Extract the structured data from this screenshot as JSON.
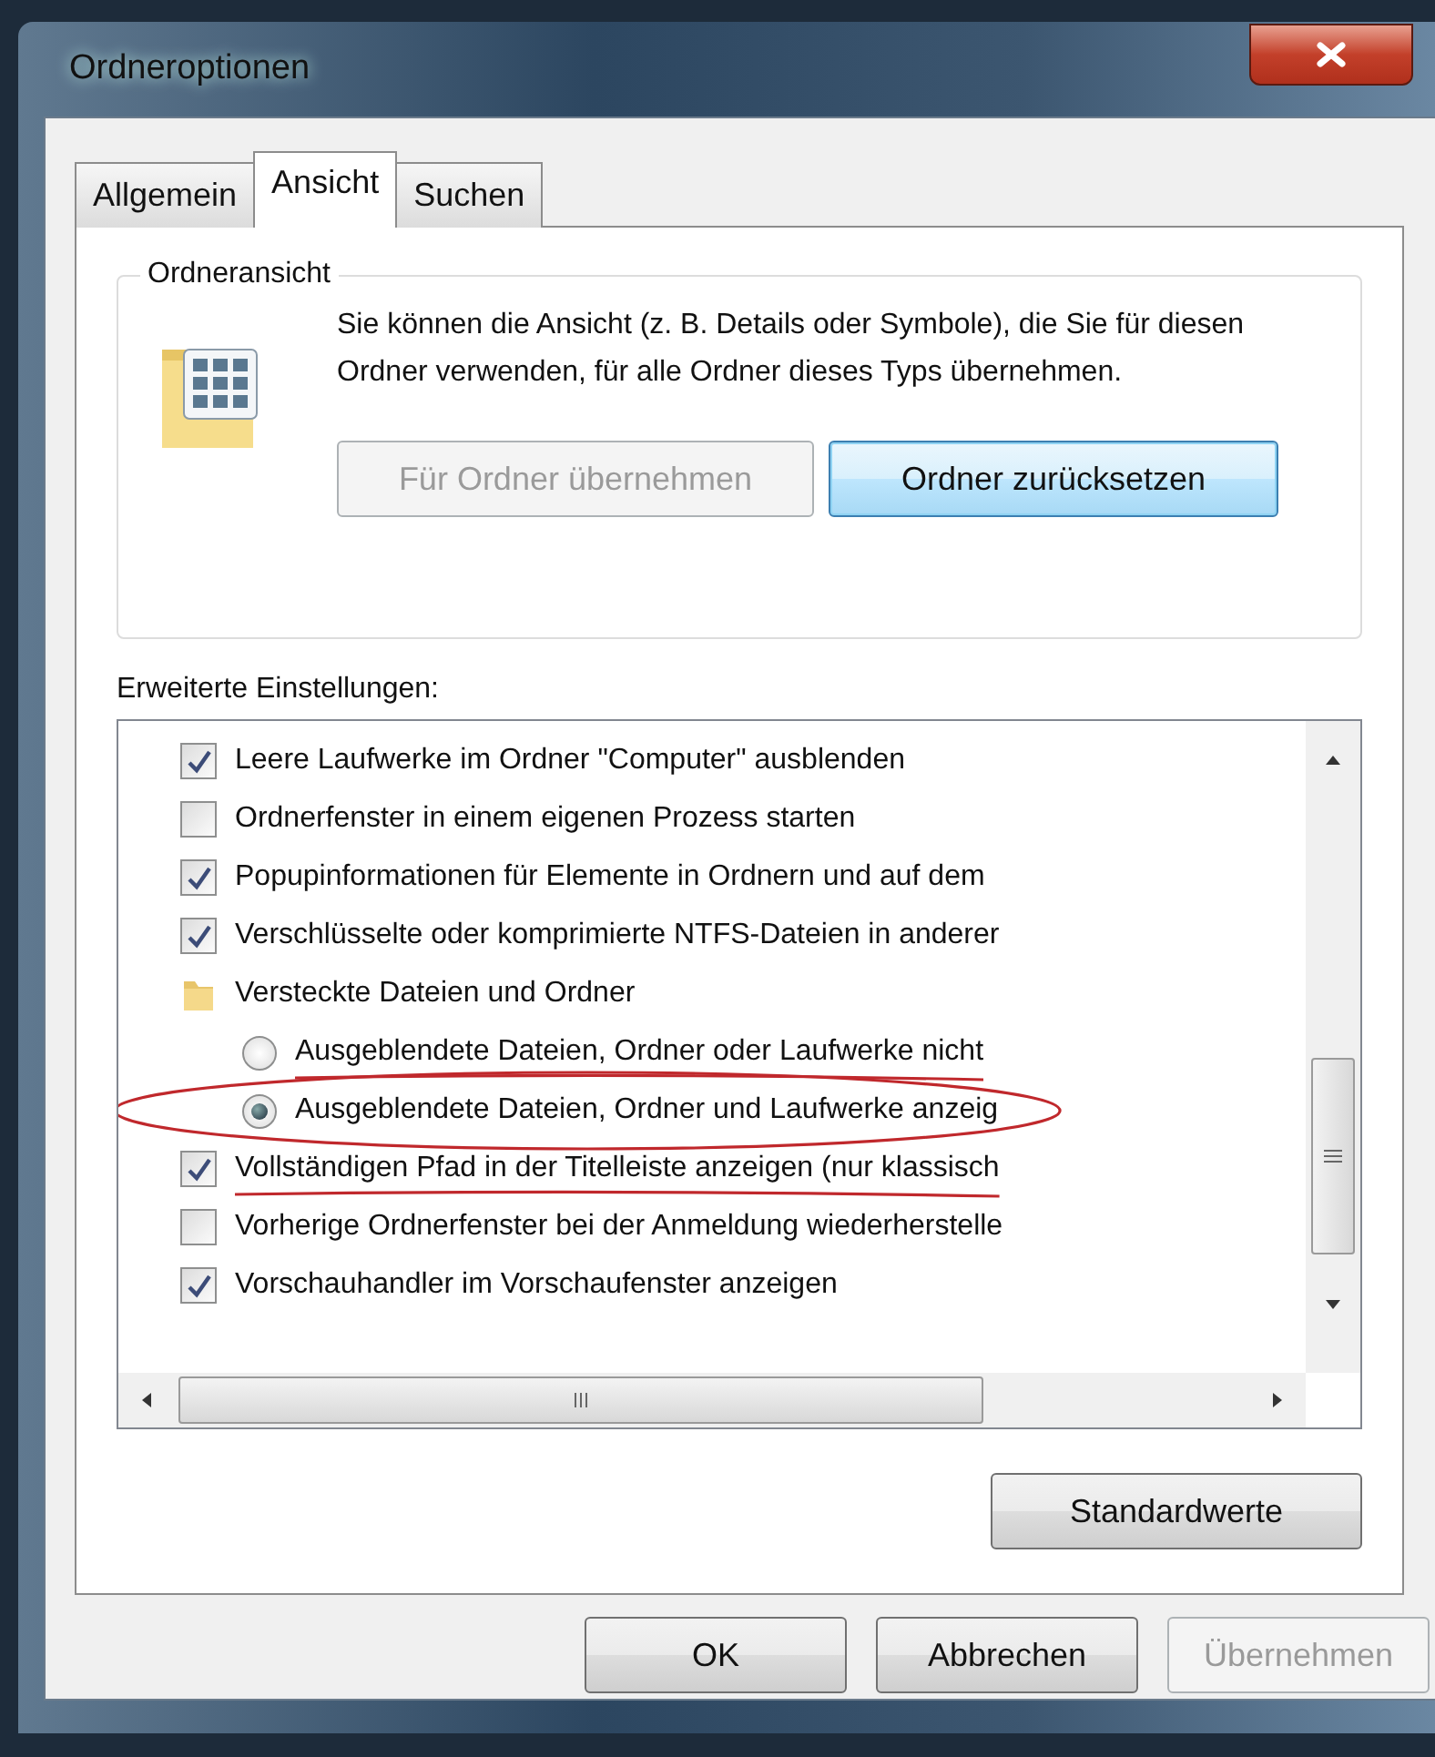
{
  "window": {
    "title": "Ordneroptionen"
  },
  "tabs": [
    {
      "label": "Allgemein",
      "selected": false
    },
    {
      "label": "Ansicht",
      "selected": true
    },
    {
      "label": "Suchen",
      "selected": false
    }
  ],
  "folder_view": {
    "title": "Ordneransicht",
    "text": "Sie können die Ansicht (z. B. Details oder Symbole), die Sie für diesen Ordner verwenden, für alle Ordner dieses Typs übernehmen.",
    "buttons": [
      {
        "label": "Für Ordner übernehmen",
        "disabled": true,
        "focused": false
      },
      {
        "label": "Ordner zurücksetzen",
        "disabled": false,
        "focused": true
      }
    ]
  },
  "advanced": {
    "label": "Erweiterte Einstellungen:",
    "items": [
      {
        "kind": "checkbox",
        "label": "Leere Laufwerke im Ordner \"Computer\" ausblenden",
        "checked": true
      },
      {
        "kind": "checkbox",
        "label": "Ordnerfenster in einem eigenen Prozess starten",
        "checked": false
      },
      {
        "kind": "checkbox",
        "label": "Popupinformationen für Elemente in Ordnern und auf dem",
        "checked": true
      },
      {
        "kind": "checkbox",
        "label": "Verschlüsselte oder komprimierte NTFS-Dateien in anderer",
        "checked": true
      },
      {
        "kind": "folder",
        "label": "Versteckte Dateien und Ordner",
        "children": [
          {
            "kind": "radio",
            "label": "Ausgeblendete Dateien, Ordner oder Laufwerke nicht",
            "selected": false,
            "struck": true
          },
          {
            "kind": "radio",
            "label": "Ausgeblendete Dateien, Ordner und Laufwerke anzeig",
            "selected": true,
            "circled": true
          }
        ]
      },
      {
        "kind": "checkbox",
        "label": "Vollständigen Pfad in der Titelleiste anzeigen (nur klassisch",
        "checked": true,
        "struck": true
      },
      {
        "kind": "checkbox",
        "label": "Vorherige Ordnerfenster bei der Anmeldung wiederherstelle",
        "checked": false
      },
      {
        "kind": "checkbox",
        "label": "Vorschauhandler im Vorschaufenster anzeigen",
        "checked": true
      }
    ],
    "defaults_button": "Standardwerte"
  },
  "buttons": [
    {
      "label": "OK",
      "disabled": false
    },
    {
      "label": "Abbrechen",
      "disabled": false
    },
    {
      "label": "Übernehmen",
      "disabled": true
    }
  ]
}
